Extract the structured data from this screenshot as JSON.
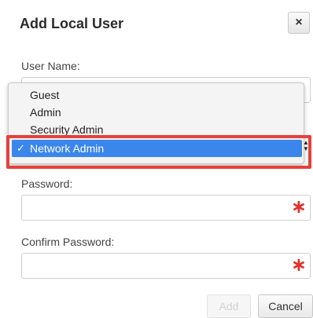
{
  "dialog": {
    "title": "Add Local User",
    "close_label": "×"
  },
  "form": {
    "username_label": "User Name:",
    "password_label": "Password:",
    "confirm_password_label": "Confirm Password:",
    "required_marker": "∗"
  },
  "role_dropdown": {
    "options": [
      "Guest",
      "Admin",
      "Security Admin",
      "Network Admin"
    ],
    "selected_index": 3,
    "selected_check": "✓",
    "arrows": "▲▼"
  },
  "buttons": {
    "add_label": "Add",
    "cancel_label": "Cancel"
  },
  "colors": {
    "selection": "#3a86ea",
    "highlight": "#e6403a",
    "required": "#e0322e"
  }
}
